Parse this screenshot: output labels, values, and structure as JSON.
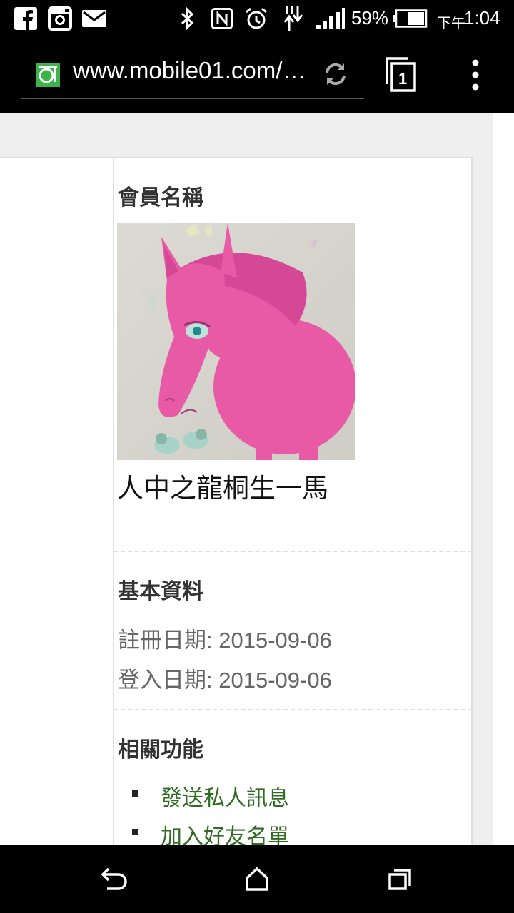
{
  "status_bar": {
    "battery_percent": "59%",
    "time_prefix": "下午",
    "time": "1:04",
    "icons": [
      "facebook-icon",
      "instagram-icon",
      "mail-icon",
      "bluetooth-icon",
      "nfc-icon",
      "alarm-icon",
      "data-transfer-icon",
      "signal-icon",
      "battery-icon"
    ]
  },
  "browser": {
    "url": "www.mobile01.com/…",
    "tab_count": "1",
    "icons": [
      "site-favicon-icon",
      "reload-icon",
      "tabs-icon",
      "overflow-menu-icon"
    ]
  },
  "profile": {
    "section_member_title": "會員名稱",
    "username": "人中之龍桐生一馬",
    "section_basic_title": "基本資料",
    "register_label": "註冊日期:",
    "register_date": "2015-09-06",
    "login_label": "登入日期:",
    "login_date": "2015-09-06",
    "section_functions_title": "相關功能",
    "functions": [
      {
        "label": "發送私人訊息"
      },
      {
        "label": "加入好友名單"
      }
    ]
  },
  "colors": {
    "link": "#2f6b22",
    "avatar_pink": "#e85aa6",
    "favicon_green": "#3cb44a"
  },
  "nav_bar": {
    "icons": [
      "back-icon",
      "home-icon",
      "recents-icon"
    ]
  }
}
